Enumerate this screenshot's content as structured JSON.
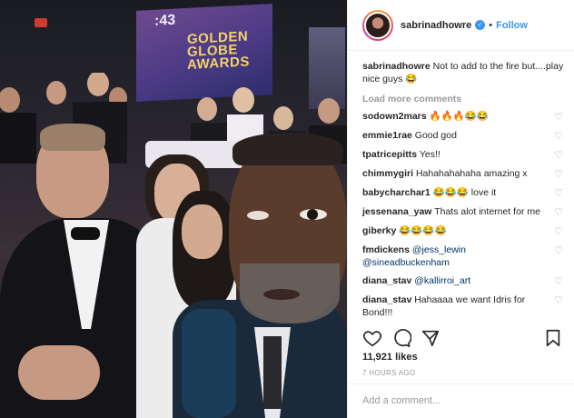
{
  "post": {
    "username": "sabrinadhowre",
    "follow_label": "Follow",
    "separator": "•",
    "verified_mark": "✓",
    "caption_user": "sabrinadhowre",
    "caption_text": "Not to add to the fire but....play nice guys 😂",
    "load_more": "Load more comments",
    "likes": "11,921 likes",
    "time": "7 HOURS AGO",
    "add_comment_placeholder": "Add a comment..."
  },
  "photo": {
    "screen_timer": ":43",
    "screen_text_1": "GOLDEN",
    "screen_text_2": "GLOBE",
    "screen_text_3": "AWARDS"
  },
  "comments": [
    {
      "user": "sodown2mars",
      "text": "🔥🔥🔥😂😂"
    },
    {
      "user": "emmie1rae",
      "text": "Good god"
    },
    {
      "user": "tpatricepitts",
      "text": "Yes!!"
    },
    {
      "user": "chimmygiri",
      "text": "Hahahahahaha amazing x"
    },
    {
      "user": "babycharchar1",
      "text": "😂😂😂 love it"
    },
    {
      "user": "jessenana_yaw",
      "text": "Thats alot internet for me"
    },
    {
      "user": "giberky",
      "text": "😂😂😂😂"
    },
    {
      "user": "fmdickens",
      "text": "",
      "mention": "@jess_lewin @sineadbuckenham"
    },
    {
      "user": "diana_stav",
      "text": "",
      "mention": "@kallirroi_art"
    },
    {
      "user": "diana_stav",
      "text": "Hahaaaa we want Idris for Bond!!!"
    }
  ],
  "icons": {
    "like": "heart-icon",
    "comment": "comment-icon",
    "share": "share-icon",
    "save": "bookmark-icon",
    "comment_like": "heart-outline-icon"
  },
  "colors": {
    "link_blue": "#3897f0",
    "text": "#262626",
    "muted": "#999999"
  }
}
